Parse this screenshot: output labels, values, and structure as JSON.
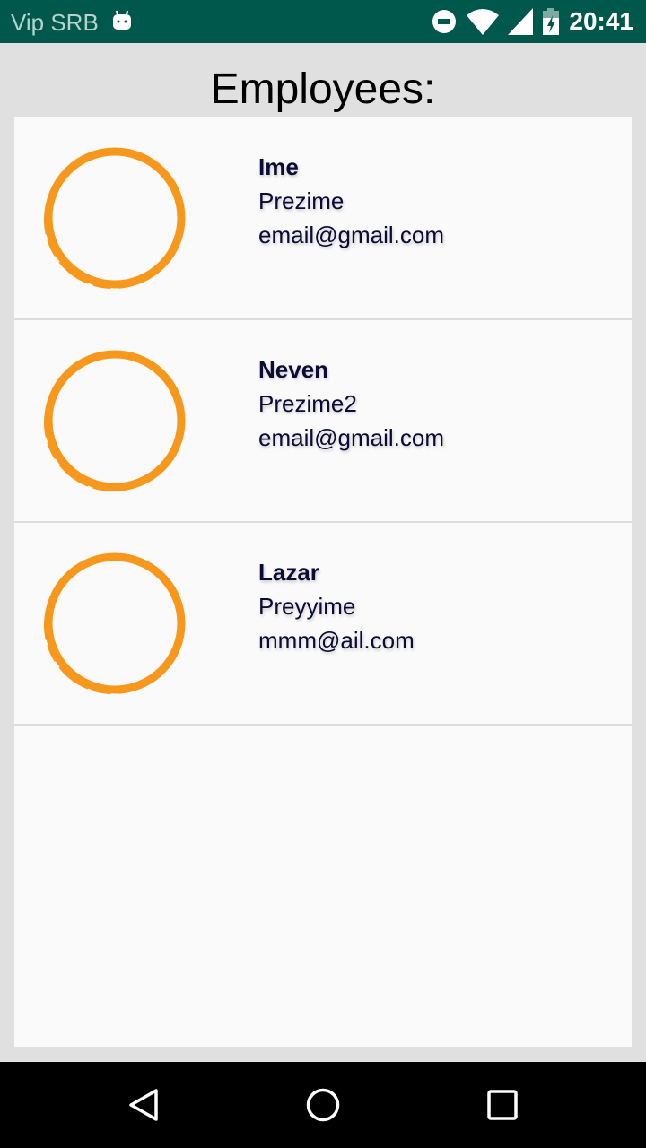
{
  "status_bar": {
    "carrier": "Vip SRB",
    "time": "20:41"
  },
  "page": {
    "title": "Employees:"
  },
  "accent_color": "#f7981d",
  "employees": [
    {
      "first_name": "Ime",
      "last_name": "Prezime",
      "email": "email@gmail.com"
    },
    {
      "first_name": "Neven",
      "last_name": "Prezime2",
      "email": "email@gmail.com"
    },
    {
      "first_name": "Lazar",
      "last_name": "Preyyime",
      "email": "mmm@ail.com"
    }
  ]
}
